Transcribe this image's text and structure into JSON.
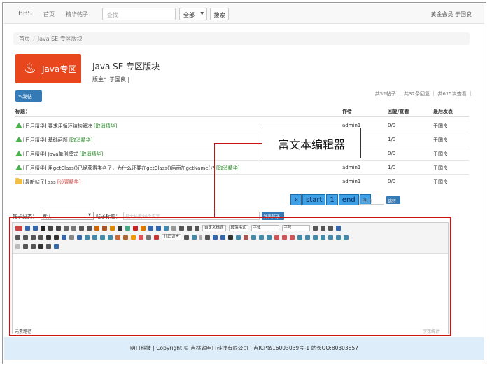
{
  "navbar": {
    "brand": "BBS",
    "links": [
      "首页",
      "精华帖子"
    ],
    "search_placeholder": "查找",
    "scope": "全部",
    "search_button": "搜索",
    "user": "黄金会员 于国良"
  },
  "breadcrumb": {
    "home": "首页",
    "current": "Java SE 专区版块"
  },
  "forum": {
    "logo_text": "Java专区",
    "title": "Java SE 专区版块",
    "moderator": "版主：于国良 |"
  },
  "stats": "共52帖子 ｜ 共32条回复 ｜ 共615次查看 ｜",
  "new_post_button": "发帖",
  "table": {
    "headers": {
      "title": "标题：",
      "author": "作者",
      "replies": "回复/查看",
      "last": "最后发表"
    },
    "rows": [
      {
        "icon": "up-arrow-icon",
        "prefix": "[日月精华]",
        "title": "要求用循环结构解决",
        "action": "[取消精华]",
        "author": "admin1",
        "replies": "0/0",
        "last": "于国良"
      },
      {
        "icon": "up-arrow-icon",
        "prefix": "[日月精华]",
        "title": "基础问题",
        "action": "[取消精华]",
        "author": "",
        "replies": "1/0",
        "last": "于国良"
      },
      {
        "icon": "up-arrow-icon",
        "prefix": "[日月精华]",
        "title": "Java单例模式",
        "action": "[取消精华]",
        "author": "",
        "replies": "0/0",
        "last": "于国良"
      },
      {
        "icon": "up-arrow-icon",
        "prefix": "[日月精华]",
        "title": "用getClass()已经获得类名了，为什么还要在getClass()后面加getName()?",
        "action": "[取消精华]",
        "author": "admin1",
        "replies": "1/0",
        "last": "于国良"
      },
      {
        "icon": "folder-icon",
        "prefix": "[最新帖子]",
        "title": "sss",
        "action": "[设置精华]",
        "author": "admin1",
        "replies": "0/0",
        "last": "于国良"
      }
    ]
  },
  "annotation": "富文本编辑器",
  "pager": {
    "buttons": [
      "«",
      "start",
      "1",
      "end",
      "»"
    ],
    "input_placeholder": "共1页",
    "jump_button": "跳转"
  },
  "post_form": {
    "category_label": "帖子分类：",
    "category_value": "默认",
    "title_label": "帖子标题：",
    "title_placeholder": "最大长度80个汉字",
    "publish_button": "发表帖子"
  },
  "editor": {
    "selects": [
      "自定义标题",
      "段落格式",
      "字体",
      "字号",
      "代码语言"
    ],
    "element_path": "元素路径",
    "word_count": "字数统计"
  },
  "footer": "明日科技 | Copyright © 吉林省明日科技有限公司 | 吉ICP备16003039号-1 站长QQ:80303857",
  "colors": {
    "primary": "#337ab7",
    "logo": "#e8461c",
    "highlight": "#cc1111",
    "pager": "#3fa0e6"
  }
}
